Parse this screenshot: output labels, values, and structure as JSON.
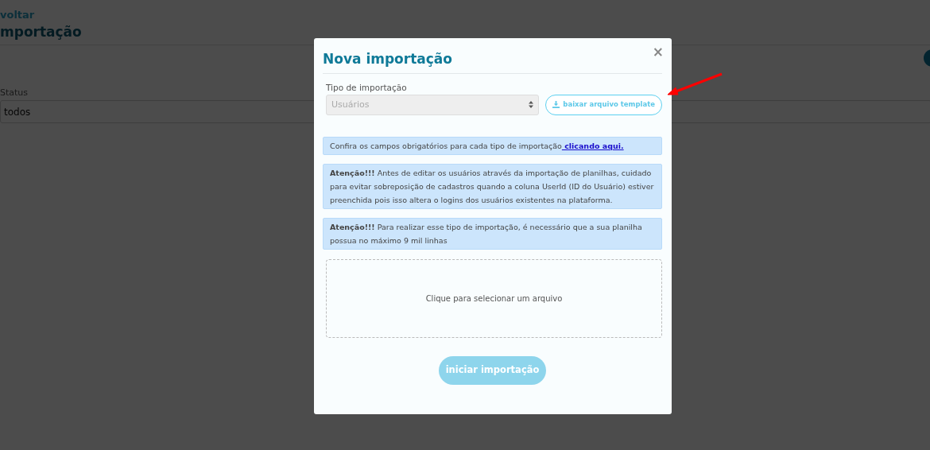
{
  "page": {
    "back_link": "voltar",
    "title": "mportação",
    "status_filter": {
      "label": "Status",
      "value": "todos"
    }
  },
  "modal": {
    "title": "Nova importação",
    "close": "×",
    "import_type": {
      "label": "Tipo de importação",
      "value": "Usuários",
      "disabled": true
    },
    "template_button": "baixar arquivo template",
    "alerts": [
      {
        "text": "Confira os campos obrigatórios para cada tipo de importação",
        "link": " clicando aqui."
      },
      {
        "text": "**Atenção!!!** Antes de editar os usuários através da importação de planilhas, cuidado para evitar sobreposição de cadastros quando a coluna UserId (ID do Usuário) estiver preenchida pois isso altera o logins dos usuários existentes na plataforma."
      },
      {
        "text": "**Atenção!!!** Para realizar esse tipo de importação, é necessário que a sua planilha possua no máximo 9 mil linhas"
      }
    ],
    "dropzone": "Clique para selecionar um arquivo",
    "start_button": {
      "label": "iniciar importação",
      "disabled": true
    }
  },
  "annotation": {
    "kind": "arrow",
    "color": "#ff0000"
  }
}
